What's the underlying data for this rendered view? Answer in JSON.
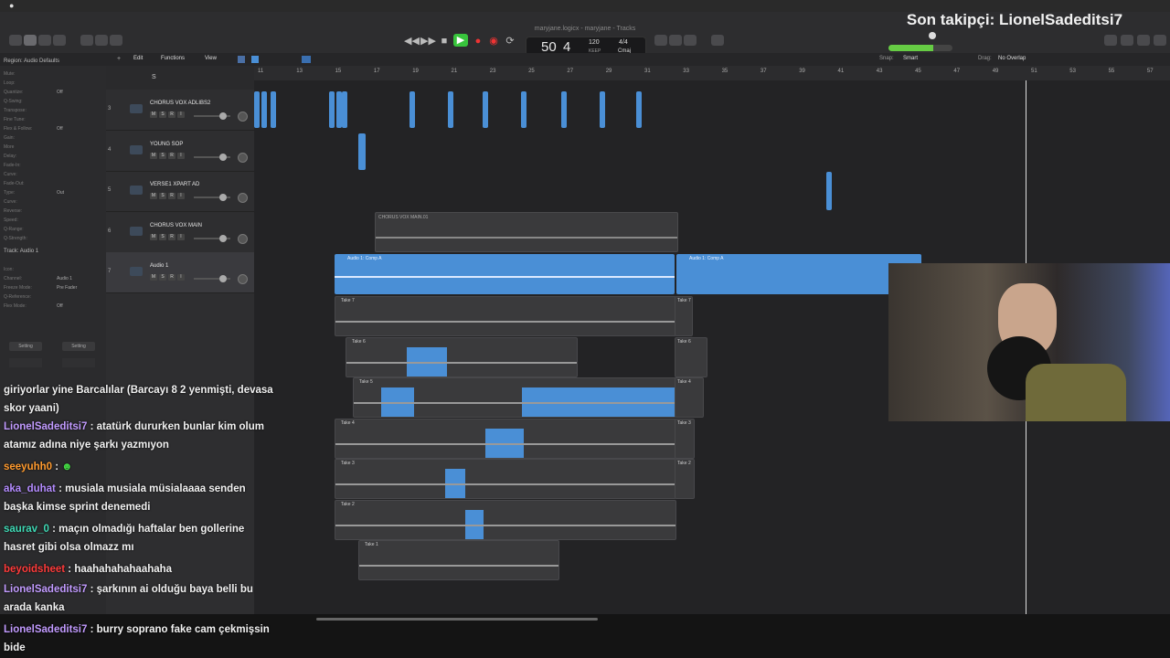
{
  "window": {
    "title": "maryjane.logicx - maryjane - Tracks"
  },
  "stream": {
    "last_follower": "Son takipçi: LionelSadeditsi7"
  },
  "transport": {
    "bars": "50",
    "beats": "4",
    "tempo": "120",
    "tempo_label": "KEEP",
    "time_sig": "4/4",
    "key": "Cmaj"
  },
  "menu": {
    "edit": "Edit",
    "functions": "Functions",
    "view": "View",
    "snap_label": "Snap:",
    "snap_value": "Smart",
    "drag_label": "Drag:",
    "drag_value": "No Overlap"
  },
  "inspector": {
    "region_header": "Region: Audio Defaults",
    "rows": [
      {
        "label": "Mute:",
        "value": ""
      },
      {
        "label": "Loop:",
        "value": ""
      },
      {
        "label": "Quantize:",
        "value": "Off"
      },
      {
        "label": "Q-Swing:",
        "value": ""
      },
      {
        "label": "Transpose:",
        "value": ""
      },
      {
        "label": "Fine Tune:",
        "value": ""
      },
      {
        "label": "Flex & Follow:",
        "value": "Off"
      },
      {
        "label": "Gain:",
        "value": ""
      },
      {
        "label": "More",
        "value": ""
      },
      {
        "label": "Delay:",
        "value": ""
      },
      {
        "label": "Fade-In:",
        "value": ""
      },
      {
        "label": "Curve:",
        "value": ""
      },
      {
        "label": "Fade-Out:",
        "value": ""
      },
      {
        "label": "Type:",
        "value": "Out"
      },
      {
        "label": "Curve:",
        "value": ""
      },
      {
        "label": "Reverse:",
        "value": ""
      },
      {
        "label": "Speed:",
        "value": ""
      },
      {
        "label": "Q-Range:",
        "value": ""
      },
      {
        "label": "Q-Strength:",
        "value": ""
      }
    ],
    "track_header": "Track: Audio 1",
    "track_rows": [
      {
        "label": "Icon:",
        "value": ""
      },
      {
        "label": "Channel:",
        "value": "Audio 1"
      },
      {
        "label": "Freeze Mode:",
        "value": "Pre Fader"
      },
      {
        "label": "Q-Reference:",
        "value": ""
      },
      {
        "label": "Flex Mode:",
        "value": "Off"
      }
    ],
    "setting_left": "Setting",
    "setting_right": "Setting"
  },
  "tracks": [
    {
      "num": "3",
      "name": "CHORUS VOX ADLIBS2"
    },
    {
      "num": "4",
      "name": "YOUNG SOP"
    },
    {
      "num": "5",
      "name": "VERSE1 XPART AD"
    },
    {
      "num": "6",
      "name": "CHORUS VOX MAIN"
    },
    {
      "num": "7",
      "name": "Audio 1"
    }
  ],
  "track_buttons": {
    "m": "M",
    "s": "S",
    "r": "R",
    "i": "I"
  },
  "ruler": [
    "11",
    "13",
    "15",
    "17",
    "19",
    "21",
    "23",
    "25",
    "27",
    "29",
    "31",
    "33",
    "35",
    "37",
    "39",
    "41",
    "43",
    "45",
    "47",
    "49",
    "51",
    "53",
    "55",
    "57"
  ],
  "regions": {
    "chorus_main": "CHORUS VOX MAIN.01",
    "comp_a_1": "Audio 1: Comp A",
    "comp_a_2": "Audio 1: Comp A",
    "takes": [
      "Take 7",
      "Take 6",
      "Take 5",
      "Take 4",
      "Take 3",
      "Take 2",
      "Take 1"
    ],
    "takes_right": [
      "Take 7",
      "Take 6",
      "Take 4",
      "Take 3",
      "Take 2"
    ]
  },
  "chat": [
    {
      "user": "",
      "text": "giriyorlar yine Barcalılar (Barcayı 8 2 yenmişti, devasa skor yaani)",
      "color": "#f2f2f2"
    },
    {
      "user": "LionelSadeditsi7",
      "text": " : atatürk dururken bunlar kim olum atamız adına niye şarkı yazmıyon",
      "color": "#c29bff"
    },
    {
      "user": "seeyuhh0",
      "text": " :",
      "color": "#ff9a2e"
    },
    {
      "user": "aka_duhat",
      "text": " : musiala musiala müsialaaaa senden başka kimse sprint denemedi",
      "color": "#b48cff"
    },
    {
      "user": "saurav_0",
      "text": " : maçın olmadığı haftalar ben gollerine hasret gibi olsa olmazz mı",
      "color": "#3fd9b5"
    },
    {
      "user": "beyoidsheet",
      "text": " : haahahahahaahaha",
      "color": "#ff3b3b"
    },
    {
      "user": "LionelSadeditsi7",
      "text": " : şarkının ai olduğu baya belli bu arada kanka",
      "color": "#c29bff"
    },
    {
      "user": "LionelSadeditsi7",
      "text": " : burry soprano fake cam çekmişsin bide",
      "color": "#c29bff"
    }
  ],
  "colors": {
    "region_blue": "#4a8fd6",
    "region_gray": "#3a3a3c",
    "play_green": "#38c43c",
    "record_red": "#e33"
  }
}
